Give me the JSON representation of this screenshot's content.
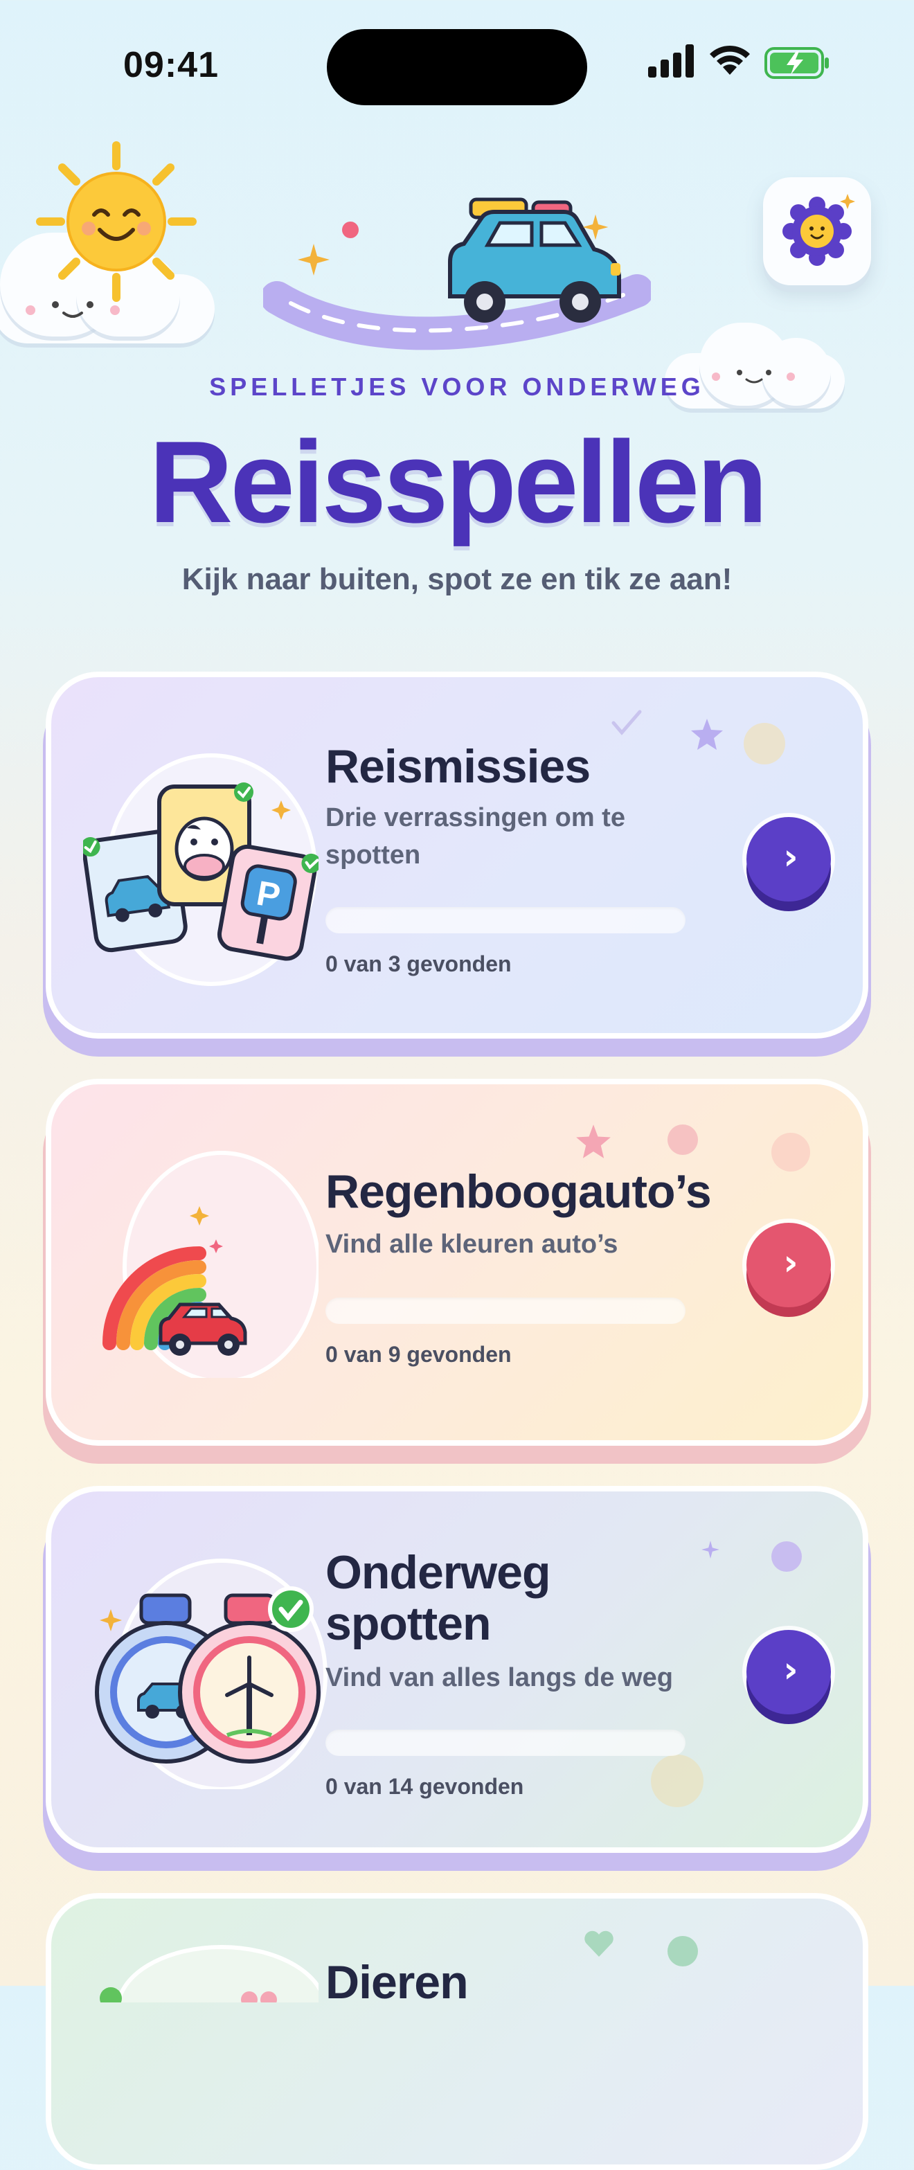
{
  "status_bar": {
    "time": "09:41"
  },
  "header": {
    "eyebrow": "SPELLETJES VOOR ONDERWEG",
    "title": "Reisspellen",
    "subtitle": "Kijk naar buiten, spot ze en tik ze aan!",
    "settings_icon": "gear-face-icon"
  },
  "games": [
    {
      "title": "Reismissies",
      "description": "Drie verrassingen om te spotten",
      "progress_text": "0 van 3 gevonden",
      "found": 0,
      "total": 3,
      "accent": "#5b3fc7",
      "icon": "mission-cards-icon"
    },
    {
      "title": "Regenboogauto’s",
      "description": "Vind alle kleuren auto’s",
      "progress_text": "0 van 9 gevonden",
      "found": 0,
      "total": 9,
      "accent": "#e4566f",
      "icon": "rainbow-car-icon"
    },
    {
      "title_line1": "Onderweg",
      "title_line2": "spotten",
      "description": "Vind van alles langs de weg",
      "progress_text": "0 van 14 gevonden",
      "found": 0,
      "total": 14,
      "accent": "#5b3fc7",
      "icon": "road-spot-badges-icon"
    },
    {
      "title": "Dieren",
      "icon": "animals-icon"
    }
  ]
}
